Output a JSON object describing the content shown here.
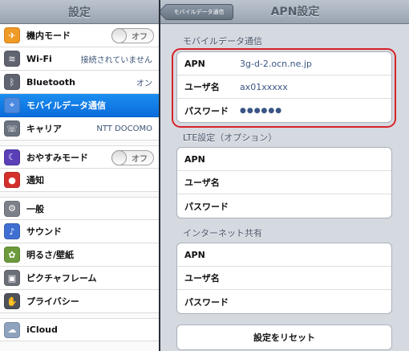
{
  "sidebar": {
    "title": "設定",
    "items": [
      {
        "name": "airplane",
        "label": "機内モード",
        "icon": "airplane-icon",
        "glyph": "✈",
        "color": "#f09a26",
        "toggle": "オフ"
      },
      {
        "name": "wifi",
        "label": "Wi-Fi",
        "icon": "wifi-icon",
        "glyph": "≋",
        "color": "#5f6470",
        "value": "接続されていません"
      },
      {
        "name": "bluetooth",
        "label": "Bluetooth",
        "icon": "bluetooth-icon",
        "glyph": "ᛒ",
        "color": "#5f6470",
        "value": "オン"
      },
      {
        "name": "mobile-data",
        "label": "モバイルデータ通信",
        "icon": "antenna-icon",
        "glyph": "⌖",
        "color": "#4c8ae0",
        "selected": true
      },
      {
        "name": "carrier",
        "label": "キャリア",
        "icon": "phone-icon",
        "glyph": "☏",
        "color": "#6b7280",
        "value": "NTT DOCOMO"
      },
      {
        "name": "do-not-disturb",
        "label": "おやすみモード",
        "icon": "moon-icon",
        "glyph": "☾",
        "color": "#5a3fb8",
        "toggle": "オフ"
      },
      {
        "name": "notifications",
        "label": "通知",
        "icon": "notification-icon",
        "glyph": "●",
        "color": "#d4302b"
      },
      {
        "name": "general",
        "label": "一般",
        "icon": "gear-icon",
        "glyph": "⚙",
        "color": "#7c8088"
      },
      {
        "name": "sounds",
        "label": "サウンド",
        "icon": "speaker-icon",
        "glyph": "♪",
        "color": "#3f6fd1"
      },
      {
        "name": "brightness",
        "label": "明るさ/壁紙",
        "icon": "flower-icon",
        "glyph": "✿",
        "color": "#6c9a3c"
      },
      {
        "name": "picture-frame",
        "label": "ピクチャフレーム",
        "icon": "picture-frame-icon",
        "glyph": "▣",
        "color": "#6b6f78"
      },
      {
        "name": "privacy",
        "label": "プライバシー",
        "icon": "hand-icon",
        "glyph": "✋",
        "color": "#4e525a"
      },
      {
        "name": "icloud",
        "label": "iCloud",
        "icon": "cloud-icon",
        "glyph": "☁",
        "color": "#8fa3bf"
      }
    ]
  },
  "detail": {
    "back_label": "モバイルデータ通信",
    "title": "APN設定",
    "sections": {
      "mobile": {
        "header": "モバイルデータ通信",
        "apn_label": "APN",
        "apn_value": "3g-d-2.ocn.ne.jp",
        "user_label": "ユーザ名",
        "user_value": "ax01xxxxx",
        "pass_label": "パスワード",
        "pass_value": "●●●●●●"
      },
      "lte": {
        "header": "LTE設定（オプション）",
        "apn_label": "APN",
        "user_label": "ユーザ名",
        "pass_label": "パスワード"
      },
      "tethering": {
        "header": "インターネット共有",
        "apn_label": "APN",
        "user_label": "ユーザ名",
        "pass_label": "パスワード"
      }
    },
    "reset_label": "設定をリセット"
  },
  "colors": {
    "accent": "#0b6cdc",
    "highlight": "#d8232a"
  }
}
